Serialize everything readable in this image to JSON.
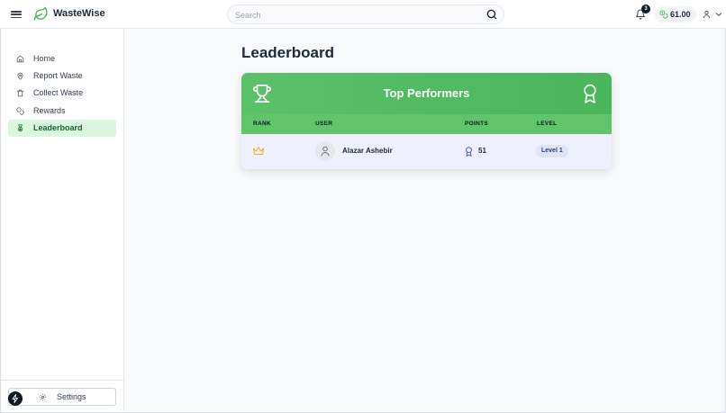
{
  "app": {
    "title": "WasteWise",
    "brand_color": "#4ab55d"
  },
  "header": {
    "search": {
      "placeholder": "Search",
      "value": ""
    },
    "notifications": {
      "count": "3"
    },
    "balance": "61.00"
  },
  "sidebar": {
    "items": [
      {
        "label": "Home",
        "icon": "home-icon"
      },
      {
        "label": "Report Waste",
        "icon": "map-pin-icon"
      },
      {
        "label": "Collect Waste",
        "icon": "trash-icon"
      },
      {
        "label": "Rewards",
        "icon": "coins-icon"
      },
      {
        "label": "Leaderboard",
        "icon": "medal-icon",
        "active": true
      }
    ],
    "settings_label": "Settings"
  },
  "main": {
    "page_title": "Leaderboard",
    "card": {
      "title": "Top Performers",
      "columns": {
        "rank": "RANK",
        "user": "USER",
        "points": "POINTS",
        "level": "LEVEL"
      },
      "rows": [
        {
          "rank_icon": "crown-icon",
          "user": "Alazar Ashebir",
          "points": "51",
          "level": "Level 1"
        }
      ]
    }
  }
}
